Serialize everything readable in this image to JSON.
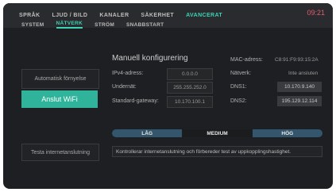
{
  "topTabs": [
    {
      "label": "SPRÅK"
    },
    {
      "label": "LJUD / BILD"
    },
    {
      "label": "KANALER"
    },
    {
      "label": "SÄKERHET"
    },
    {
      "label": "AVANCERAT"
    }
  ],
  "topTabsActive": "AVANCERAT",
  "clock": "09:21",
  "subTabs": [
    {
      "label": "SYSTEM"
    },
    {
      "label": "NÄTVERK"
    },
    {
      "label": "STRÖM"
    },
    {
      "label": "SNABBSTART"
    }
  ],
  "subTabsActive": "NÄTVERK",
  "buttons": {
    "auto_renew": "Automatisk förnyelse",
    "connect_wifi": "Anslut WiFi",
    "test_internet": "Testa internetanslutning"
  },
  "manual": {
    "title": "Manuell konfigurering",
    "ipv4_label": "IPv4-adress:",
    "ipv4_value": "0.0.0.0",
    "subnet_label": "Undernät:",
    "subnet_value": "255.255.252.0",
    "gateway_label": "Standard-gateway:",
    "gateway_value": "10.170.100.1"
  },
  "network": {
    "mac_label": "MAC-adress:",
    "mac_value": "C8:91:F9:93:15:2A",
    "network_label": "Nätverk:",
    "network_value": "Inte ansluten",
    "dns1_label": "DNS1:",
    "dns1_value": "10.170.9.140",
    "dns2_label": "DNS2:",
    "dns2_value": "195.129.12.114"
  },
  "speed": {
    "low": "LÅG",
    "medium": "MEDIUM",
    "high": "HÖG",
    "selected": "MEDIUM"
  },
  "info_text": "Kontrollerar internetanslutning och förbereder test av uppkopplingshastighet.",
  "colors": {
    "accent": "#3dd1b5",
    "button_primary": "#2fb39b",
    "clock": "#e55a6e",
    "segment": "#34566d"
  }
}
